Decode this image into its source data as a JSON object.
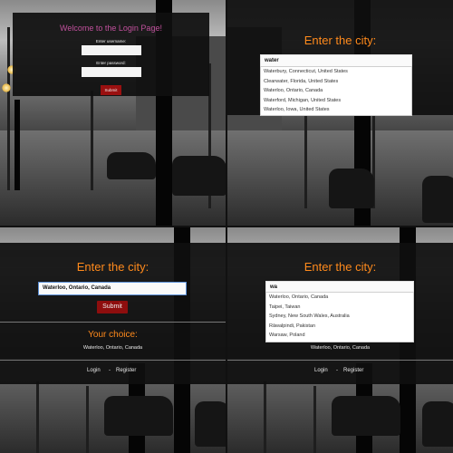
{
  "panel1": {
    "title": "Welcome to the Login Page!",
    "username_label": "Enter username:",
    "password_label": "Enter password:",
    "submit_label": "Submit"
  },
  "panel2": {
    "title": "Enter the city:",
    "search_value": "water",
    "suggestions": [
      "Waterbury, Connecticut, United States",
      "Clearwater, Florida, United States",
      "Waterloo, Ontario, Canada",
      "Waterford, Michigan, United States",
      "Waterloo, Iowa, United States"
    ]
  },
  "panel3": {
    "title": "Enter the city:",
    "search_value": "Waterloo, Ontario, Canada",
    "submit_label": "Submit",
    "choice_title": "Your choice:",
    "choice_value": "Waterloo, Ontario, Canada",
    "login_label": "Login",
    "separator": "-",
    "register_label": "Register"
  },
  "panel4": {
    "title": "Enter the city:",
    "search_value": "wa",
    "suggestions": [
      "Waterloo, Ontario, Canada",
      "Taipei, Taiwan",
      "Sydney, New South Wales, Australia",
      "Rāwalpindi, Pakistan",
      "Warsaw, Poland"
    ],
    "choice_value": "Waterloo, Ontario, Canada",
    "login_label": "Login",
    "separator": "-",
    "register_label": "Register"
  }
}
